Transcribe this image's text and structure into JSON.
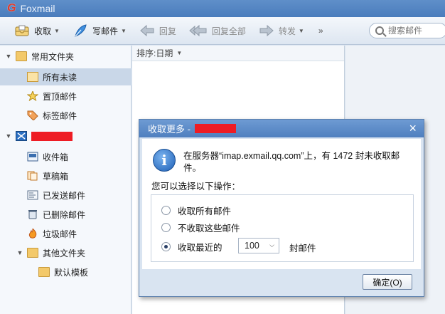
{
  "window": {
    "title": "Foxmail",
    "logo": "G"
  },
  "toolbar": {
    "receive": "收取",
    "compose": "写邮件",
    "reply": "回复",
    "reply_all": "回复全部",
    "forward": "转发",
    "more": "»",
    "search_placeholder": "搜索邮件"
  },
  "sidebar": {
    "common_folders": "常用文件夹",
    "all_unread": "所有未读",
    "pinned": "置顶邮件",
    "tagged": "标签邮件",
    "inbox": "收件箱",
    "drafts": "草稿箱",
    "sent": "已发送邮件",
    "deleted": "已删除邮件",
    "junk": "垃圾邮件",
    "other_folders": "其他文件夹",
    "default_template": "默认模板"
  },
  "list": {
    "sort_label": "排序:日期"
  },
  "dialog": {
    "title": "收取更多 -",
    "message": "在服务器“imap.exmail.qq.com”上，有 1472 封未收取邮件。",
    "prompt": "您可以选择以下操作：",
    "option_all": "收取所有邮件",
    "option_none": "不收取这些邮件",
    "option_recent": "收取最近的",
    "recent_count": "100",
    "unit": "封邮件",
    "ok_label": "确定(O)",
    "selected_option": "option_recent"
  },
  "colors": {
    "accent": "#4f7fbf",
    "redaction": "#ee1c24"
  }
}
